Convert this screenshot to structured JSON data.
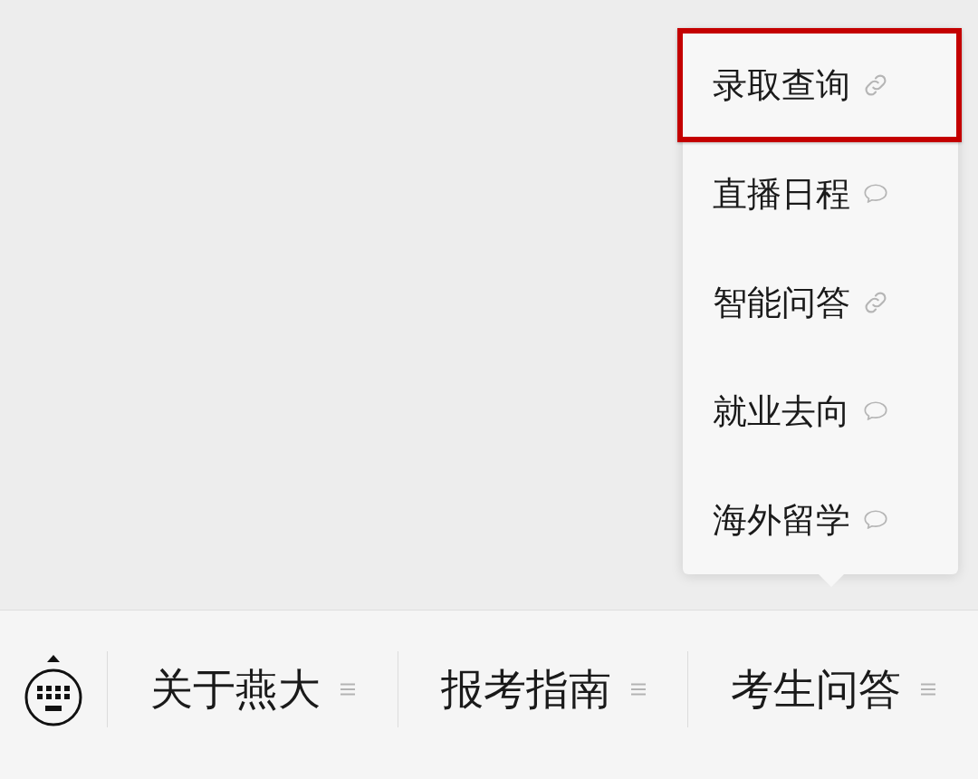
{
  "menu": [
    {
      "label": "关于燕大"
    },
    {
      "label": "报考指南"
    },
    {
      "label": "考生问答",
      "submenu": [
        {
          "label": "录取查询",
          "kind": "link",
          "highlighted": true
        },
        {
          "label": "直播日程",
          "kind": "message",
          "highlighted": false
        },
        {
          "label": "智能问答",
          "kind": "link",
          "highlighted": false
        },
        {
          "label": "就业去向",
          "kind": "message",
          "highlighted": false
        },
        {
          "label": "海外留学",
          "kind": "message",
          "highlighted": false
        }
      ]
    }
  ]
}
